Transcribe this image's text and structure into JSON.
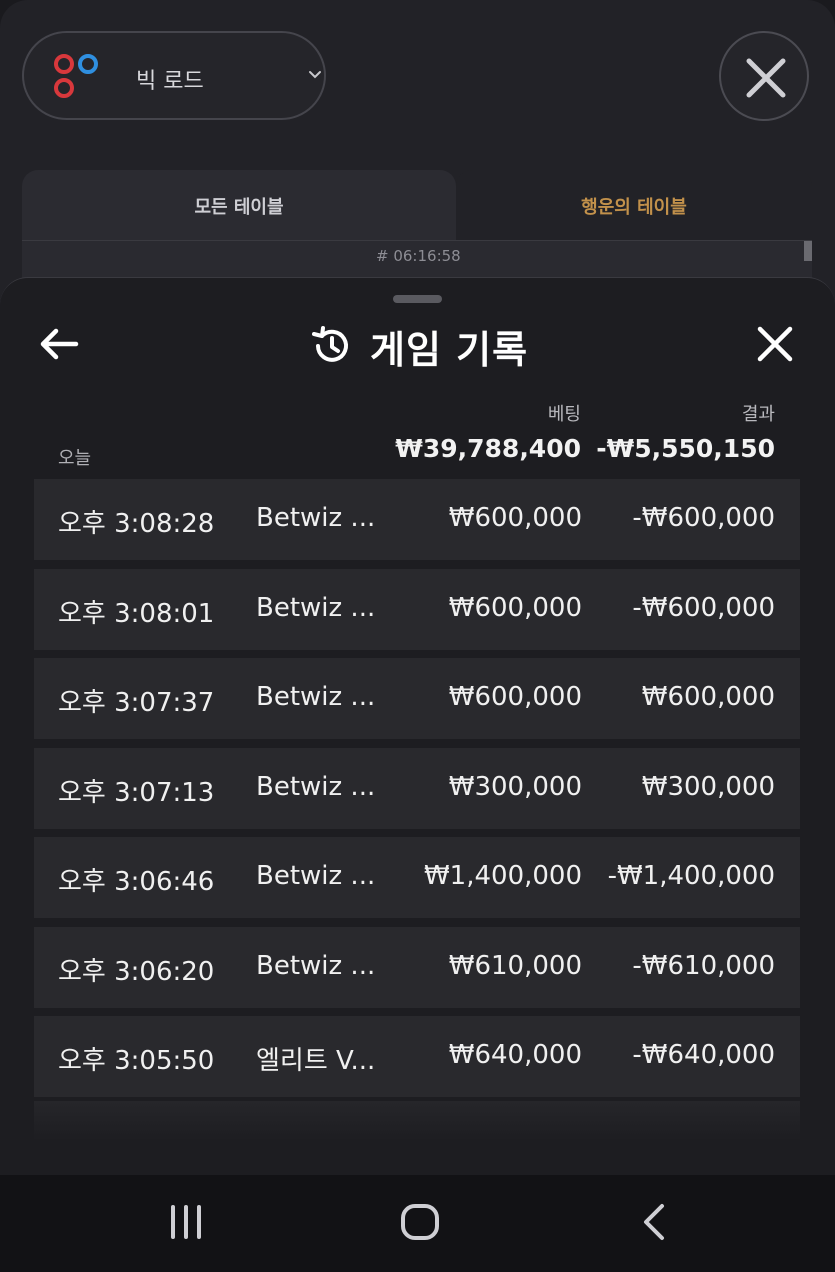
{
  "background": {
    "road_select": {
      "label": "빅 로드"
    },
    "tabs": {
      "all_tables": "모든 테이블",
      "lucky_tables": "행운의 테이블"
    },
    "card_id": "# 06:16:58"
  },
  "sheet": {
    "title": "게임 기록",
    "columns": {
      "bet": "베팅",
      "result": "결과"
    },
    "today_label": "오늘",
    "totals": {
      "bet": "₩39,788,400",
      "result": "-₩5,550,150"
    },
    "rows": [
      {
        "time": "오후 3:08:28",
        "game": "Betwiz ...",
        "bet": "₩600,000",
        "result": "-₩600,000"
      },
      {
        "time": "오후 3:08:01",
        "game": "Betwiz ...",
        "bet": "₩600,000",
        "result": "-₩600,000"
      },
      {
        "time": "오후 3:07:37",
        "game": "Betwiz ...",
        "bet": "₩600,000",
        "result": "₩600,000"
      },
      {
        "time": "오후 3:07:13",
        "game": "Betwiz ...",
        "bet": "₩300,000",
        "result": "₩300,000"
      },
      {
        "time": "오후 3:06:46",
        "game": "Betwiz ...",
        "bet": "₩1,400,000",
        "result": "-₩1,400,000"
      },
      {
        "time": "오후 3:06:20",
        "game": "Betwiz ...",
        "bet": "₩610,000",
        "result": "-₩610,000"
      },
      {
        "time": "오후 3:05:50",
        "game": "엘리트 V...",
        "bet": "₩640,000",
        "result": "-₩640,000"
      }
    ]
  },
  "colors": {
    "accent_gold": "#c2914b",
    "logo_red": "#d8383c",
    "logo_blue": "#2f8fe0",
    "row_bg": "#29292d"
  },
  "icons": {
    "road_logo": "big-road-logo-icon",
    "chevron": "chevron-down-icon",
    "close": "close-icon",
    "back": "arrow-left-icon",
    "history": "history-icon",
    "nav_recent": "recent-apps-icon",
    "nav_home": "home-icon",
    "nav_back": "nav-back-icon"
  }
}
